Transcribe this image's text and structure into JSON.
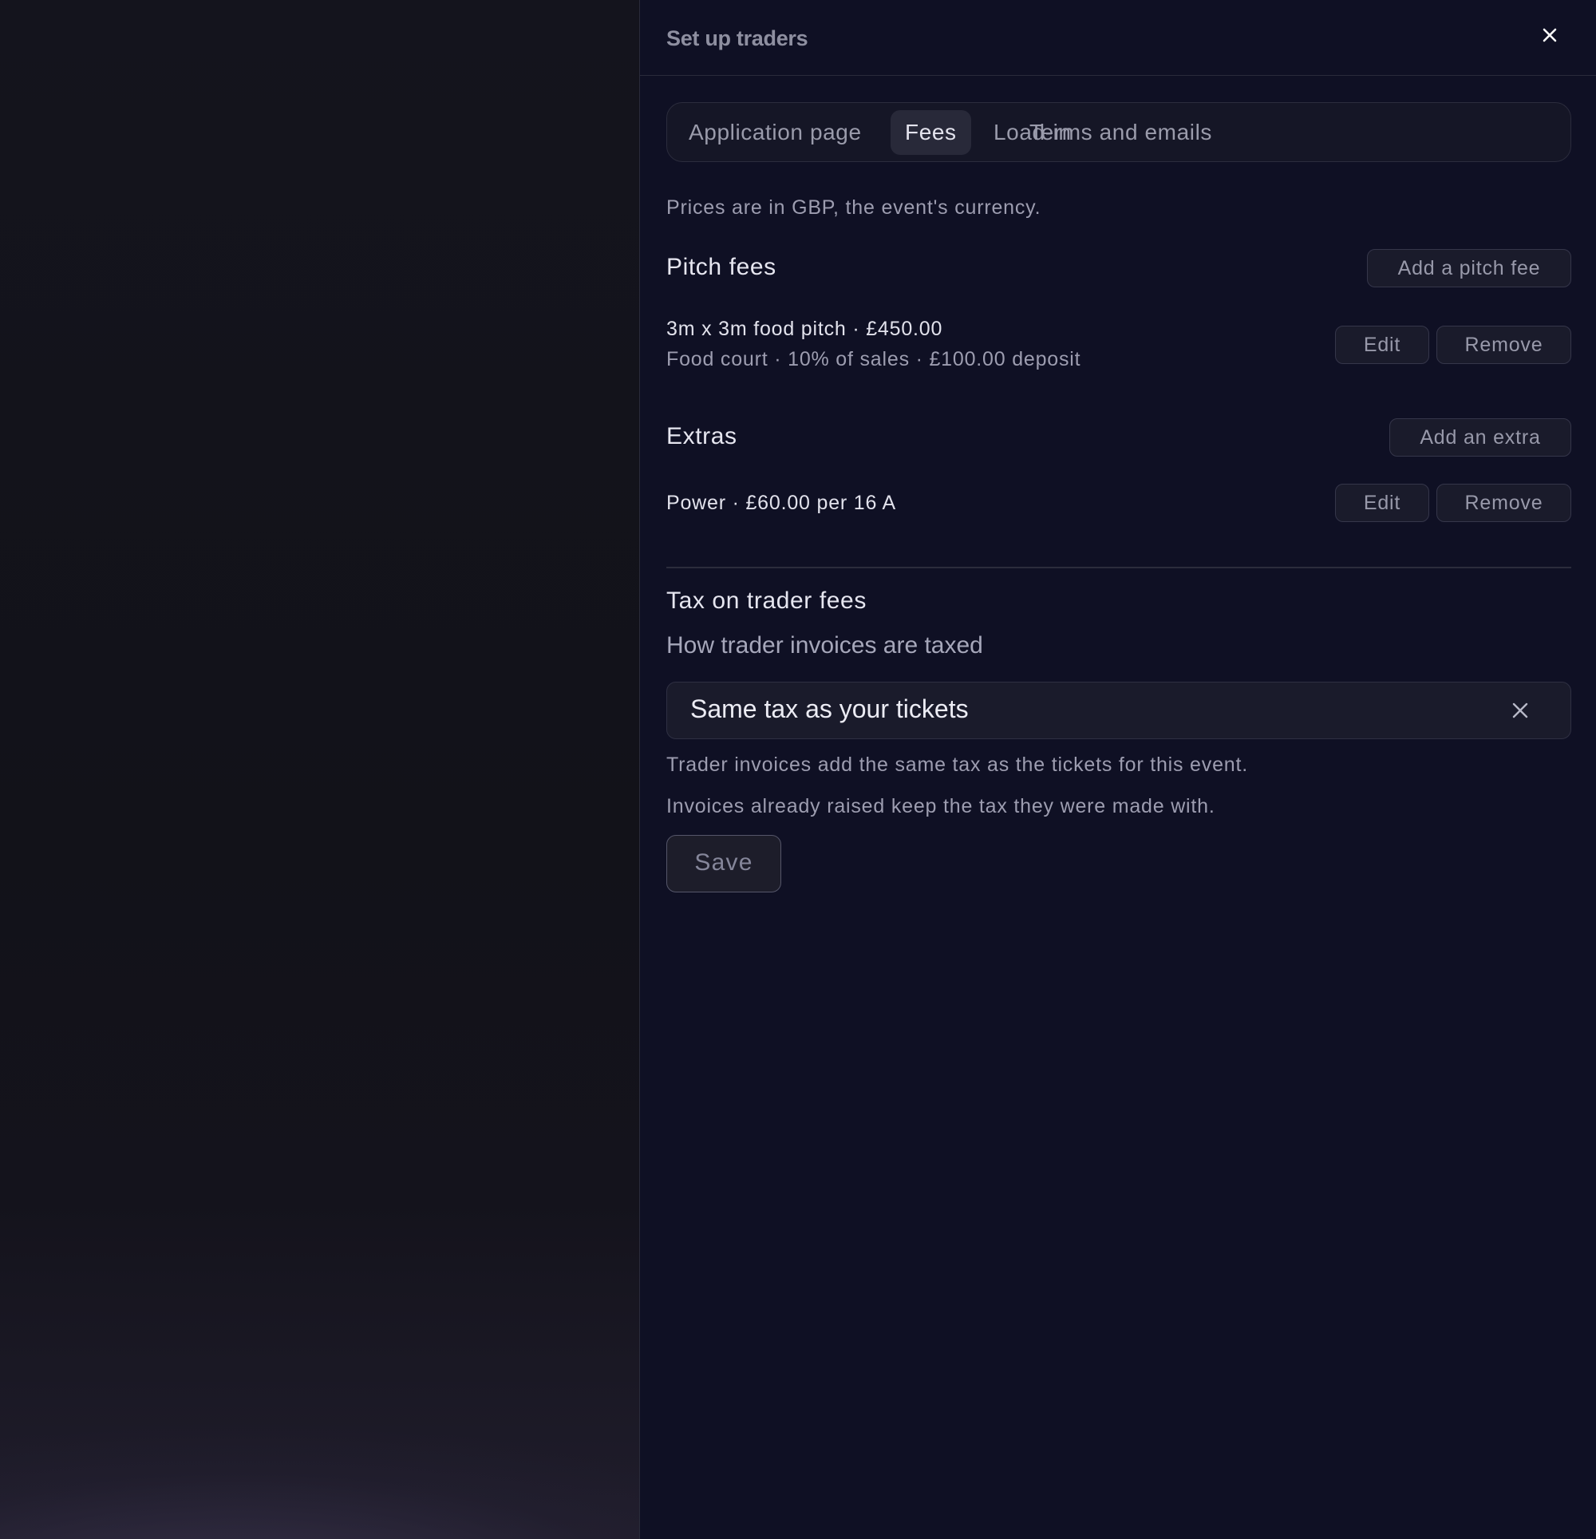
{
  "panel": {
    "title": "Set up traders"
  },
  "tabs": [
    {
      "label": "Application page",
      "active": false
    },
    {
      "label": "Fees",
      "active": true
    },
    {
      "label": "Load-in",
      "active": false
    },
    {
      "label": "Terms and emails",
      "active": false
    }
  ],
  "fees": {
    "currency_note": "Prices are in GBP, the event's currency.",
    "pitch_fees": {
      "title": "Pitch fees",
      "add_label": "Add a pitch fee",
      "items": [
        {
          "summary": "3m x 3m food pitch · £450.00",
          "details": "Food court · 10% of sales · £100.00 deposit",
          "edit_label": "Edit",
          "remove_label": "Remove"
        }
      ]
    },
    "extras": {
      "title": "Extras",
      "add_label": "Add an extra",
      "items": [
        {
          "summary": "Power · £60.00 per 16 A",
          "edit_label": "Edit",
          "remove_label": "Remove"
        }
      ]
    }
  },
  "tax": {
    "title": "Tax on trader fees",
    "field_label": "How trader invoices are taxed",
    "selected_value": "Same tax as your tickets",
    "help_line_1": "Trader invoices add the same tax as the tickets for this event.",
    "help_line_2": "Invoices already raised keep the tax they were made with.",
    "save_label": "Save"
  },
  "icons": {
    "close": "close-icon",
    "clear": "clear-icon"
  },
  "colors": {
    "panel_background": "#0f1024",
    "active_tab": "#282939",
    "text_primary": "#e6e6f0",
    "text_muted": "#9d9db0"
  }
}
